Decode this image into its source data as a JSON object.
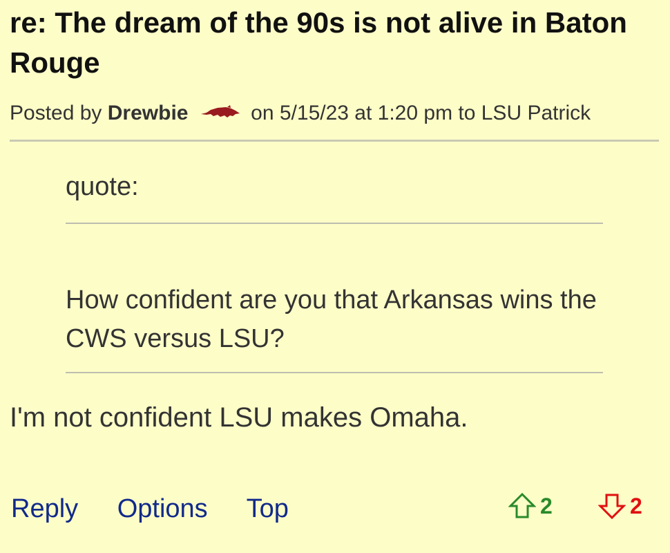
{
  "post": {
    "title": "re: The dream of the 90s is not alive in Baton Rouge",
    "meta": {
      "posted_by": "Posted by",
      "author": "Drewbie",
      "author_icon": "razorback-hog-icon",
      "on_text": "on 5/15/23 at 1:20 pm to LSU Patrick"
    },
    "quote": {
      "label": "quote:",
      "text": "How confident are you that Arkansas wins the CWS versus LSU?"
    },
    "body": "I'm not confident LSU makes Omaha."
  },
  "actions": {
    "reply": "Reply",
    "options": "Options",
    "top": "Top"
  },
  "votes": {
    "up": "2",
    "down": "2",
    "up_color": "#2a8a2a",
    "down_color": "#e01010"
  },
  "colors": {
    "background": "#fdfdc8",
    "link": "#112a8a",
    "hog": "#9a1b1f"
  }
}
